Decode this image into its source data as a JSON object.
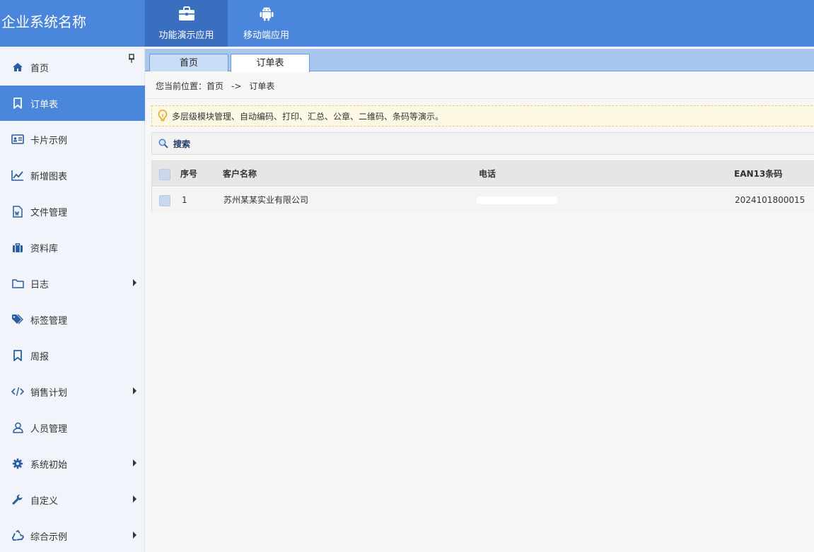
{
  "header": {
    "brand": "企业系统名称",
    "apps": [
      {
        "label": "功能演示应用",
        "icon": "briefcase-icon",
        "active": true
      },
      {
        "label": "移动端应用",
        "icon": "android-icon",
        "active": false
      }
    ]
  },
  "sidebar": {
    "items": [
      {
        "label": "首页",
        "icon": "home-icon"
      },
      {
        "label": "订单表",
        "icon": "bookmark-icon",
        "active": true
      },
      {
        "label": "卡片示例",
        "icon": "id-card-icon"
      },
      {
        "label": "新增图表",
        "icon": "line-chart-icon"
      },
      {
        "label": "文件管理",
        "icon": "word-file-icon"
      },
      {
        "label": "资料库",
        "icon": "suitcase-icon"
      },
      {
        "label": "日志",
        "icon": "folder-icon",
        "submenu": true
      },
      {
        "label": "标签管理",
        "icon": "tags-icon"
      },
      {
        "label": "周报",
        "icon": "bookmark-icon"
      },
      {
        "label": "销售计划",
        "icon": "code-icon",
        "submenu": true
      },
      {
        "label": "人员管理",
        "icon": "user-icon"
      },
      {
        "label": "系统初始",
        "icon": "gear-icon",
        "submenu": true
      },
      {
        "label": "自定义",
        "icon": "wrench-icon",
        "submenu": true
      },
      {
        "label": "综合示例",
        "icon": "recycle-icon",
        "submenu": true
      }
    ]
  },
  "tabs": [
    {
      "label": "首页",
      "active": false
    },
    {
      "label": "订单表",
      "active": true
    }
  ],
  "breadcrumb": {
    "prefix": "您当前位置：",
    "home": "首页",
    "separator": "->",
    "current": "订单表"
  },
  "notice": {
    "text": "多层级模块管理、自动编码、打印、汇总、公章、二维码、条码等演示。"
  },
  "search": {
    "label": "搜索"
  },
  "table": {
    "columns": [
      "序号",
      "客户名称",
      "电话",
      "EAN13条码"
    ],
    "rows": [
      {
        "no": "1",
        "customer": "苏州某某实业有限公司",
        "phone": "",
        "ean13": "2024101800015"
      }
    ]
  },
  "colors": {
    "primary": "#4a87dc",
    "primary_dark": "#3a6fc0",
    "tabbar": "#a8c6ee"
  }
}
